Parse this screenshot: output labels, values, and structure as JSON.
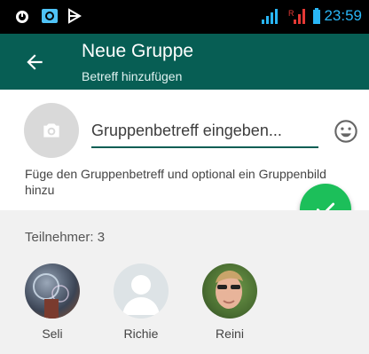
{
  "status_bar": {
    "time": "23:59",
    "icons": [
      "alarm-icon",
      "app-icon",
      "media-icon",
      "signal-icon",
      "roaming-signal-icon",
      "battery-icon"
    ]
  },
  "app_bar": {
    "title": "Neue Gruppe",
    "subtitle": "Betreff hinzufügen",
    "back_icon": "arrow-back-icon"
  },
  "subject": {
    "placeholder": "Gruppenbetreff eingeben...",
    "value": "",
    "photo_icon": "camera-icon",
    "emoji_icon": "emoji-icon"
  },
  "hint": "Füge den Gruppenbetreff und optional ein Gruppenbild hinzu",
  "fab_icon": "check-icon",
  "participants": {
    "header": "Teilnehmer: 3",
    "members": [
      {
        "name": "Seli"
      },
      {
        "name": "Richie"
      },
      {
        "name": "Reini"
      }
    ]
  },
  "colors": {
    "app_bar": "#075e54",
    "accent": "#1cbf5a",
    "status_time": "#29b6f6"
  }
}
